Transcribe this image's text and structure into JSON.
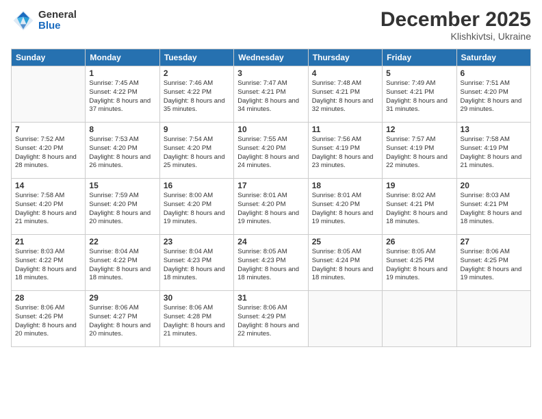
{
  "logo": {
    "general": "General",
    "blue": "Blue"
  },
  "title": "December 2025",
  "location": "Klishkivtsi, Ukraine",
  "days_header": [
    "Sunday",
    "Monday",
    "Tuesday",
    "Wednesday",
    "Thursday",
    "Friday",
    "Saturday"
  ],
  "weeks": [
    [
      {
        "day": "",
        "sunrise": "",
        "sunset": "",
        "daylight": ""
      },
      {
        "day": "1",
        "sunrise": "Sunrise: 7:45 AM",
        "sunset": "Sunset: 4:22 PM",
        "daylight": "Daylight: 8 hours and 37 minutes."
      },
      {
        "day": "2",
        "sunrise": "Sunrise: 7:46 AM",
        "sunset": "Sunset: 4:22 PM",
        "daylight": "Daylight: 8 hours and 35 minutes."
      },
      {
        "day": "3",
        "sunrise": "Sunrise: 7:47 AM",
        "sunset": "Sunset: 4:21 PM",
        "daylight": "Daylight: 8 hours and 34 minutes."
      },
      {
        "day": "4",
        "sunrise": "Sunrise: 7:48 AM",
        "sunset": "Sunset: 4:21 PM",
        "daylight": "Daylight: 8 hours and 32 minutes."
      },
      {
        "day": "5",
        "sunrise": "Sunrise: 7:49 AM",
        "sunset": "Sunset: 4:21 PM",
        "daylight": "Daylight: 8 hours and 31 minutes."
      },
      {
        "day": "6",
        "sunrise": "Sunrise: 7:51 AM",
        "sunset": "Sunset: 4:20 PM",
        "daylight": "Daylight: 8 hours and 29 minutes."
      }
    ],
    [
      {
        "day": "7",
        "sunrise": "Sunrise: 7:52 AM",
        "sunset": "Sunset: 4:20 PM",
        "daylight": "Daylight: 8 hours and 28 minutes."
      },
      {
        "day": "8",
        "sunrise": "Sunrise: 7:53 AM",
        "sunset": "Sunset: 4:20 PM",
        "daylight": "Daylight: 8 hours and 26 minutes."
      },
      {
        "day": "9",
        "sunrise": "Sunrise: 7:54 AM",
        "sunset": "Sunset: 4:20 PM",
        "daylight": "Daylight: 8 hours and 25 minutes."
      },
      {
        "day": "10",
        "sunrise": "Sunrise: 7:55 AM",
        "sunset": "Sunset: 4:20 PM",
        "daylight": "Daylight: 8 hours and 24 minutes."
      },
      {
        "day": "11",
        "sunrise": "Sunrise: 7:56 AM",
        "sunset": "Sunset: 4:19 PM",
        "daylight": "Daylight: 8 hours and 23 minutes."
      },
      {
        "day": "12",
        "sunrise": "Sunrise: 7:57 AM",
        "sunset": "Sunset: 4:19 PM",
        "daylight": "Daylight: 8 hours and 22 minutes."
      },
      {
        "day": "13",
        "sunrise": "Sunrise: 7:58 AM",
        "sunset": "Sunset: 4:19 PM",
        "daylight": "Daylight: 8 hours and 21 minutes."
      }
    ],
    [
      {
        "day": "14",
        "sunrise": "Sunrise: 7:58 AM",
        "sunset": "Sunset: 4:20 PM",
        "daylight": "Daylight: 8 hours and 21 minutes."
      },
      {
        "day": "15",
        "sunrise": "Sunrise: 7:59 AM",
        "sunset": "Sunset: 4:20 PM",
        "daylight": "Daylight: 8 hours and 20 minutes."
      },
      {
        "day": "16",
        "sunrise": "Sunrise: 8:00 AM",
        "sunset": "Sunset: 4:20 PM",
        "daylight": "Daylight: 8 hours and 19 minutes."
      },
      {
        "day": "17",
        "sunrise": "Sunrise: 8:01 AM",
        "sunset": "Sunset: 4:20 PM",
        "daylight": "Daylight: 8 hours and 19 minutes."
      },
      {
        "day": "18",
        "sunrise": "Sunrise: 8:01 AM",
        "sunset": "Sunset: 4:20 PM",
        "daylight": "Daylight: 8 hours and 19 minutes."
      },
      {
        "day": "19",
        "sunrise": "Sunrise: 8:02 AM",
        "sunset": "Sunset: 4:21 PM",
        "daylight": "Daylight: 8 hours and 18 minutes."
      },
      {
        "day": "20",
        "sunrise": "Sunrise: 8:03 AM",
        "sunset": "Sunset: 4:21 PM",
        "daylight": "Daylight: 8 hours and 18 minutes."
      }
    ],
    [
      {
        "day": "21",
        "sunrise": "Sunrise: 8:03 AM",
        "sunset": "Sunset: 4:22 PM",
        "daylight": "Daylight: 8 hours and 18 minutes."
      },
      {
        "day": "22",
        "sunrise": "Sunrise: 8:04 AM",
        "sunset": "Sunset: 4:22 PM",
        "daylight": "Daylight: 8 hours and 18 minutes."
      },
      {
        "day": "23",
        "sunrise": "Sunrise: 8:04 AM",
        "sunset": "Sunset: 4:23 PM",
        "daylight": "Daylight: 8 hours and 18 minutes."
      },
      {
        "day": "24",
        "sunrise": "Sunrise: 8:05 AM",
        "sunset": "Sunset: 4:23 PM",
        "daylight": "Daylight: 8 hours and 18 minutes."
      },
      {
        "day": "25",
        "sunrise": "Sunrise: 8:05 AM",
        "sunset": "Sunset: 4:24 PM",
        "daylight": "Daylight: 8 hours and 18 minutes."
      },
      {
        "day": "26",
        "sunrise": "Sunrise: 8:05 AM",
        "sunset": "Sunset: 4:25 PM",
        "daylight": "Daylight: 8 hours and 19 minutes."
      },
      {
        "day": "27",
        "sunrise": "Sunrise: 8:06 AM",
        "sunset": "Sunset: 4:25 PM",
        "daylight": "Daylight: 8 hours and 19 minutes."
      }
    ],
    [
      {
        "day": "28",
        "sunrise": "Sunrise: 8:06 AM",
        "sunset": "Sunset: 4:26 PM",
        "daylight": "Daylight: 8 hours and 20 minutes."
      },
      {
        "day": "29",
        "sunrise": "Sunrise: 8:06 AM",
        "sunset": "Sunset: 4:27 PM",
        "daylight": "Daylight: 8 hours and 20 minutes."
      },
      {
        "day": "30",
        "sunrise": "Sunrise: 8:06 AM",
        "sunset": "Sunset: 4:28 PM",
        "daylight": "Daylight: 8 hours and 21 minutes."
      },
      {
        "day": "31",
        "sunrise": "Sunrise: 8:06 AM",
        "sunset": "Sunset: 4:29 PM",
        "daylight": "Daylight: 8 hours and 22 minutes."
      },
      {
        "day": "",
        "sunrise": "",
        "sunset": "",
        "daylight": ""
      },
      {
        "day": "",
        "sunrise": "",
        "sunset": "",
        "daylight": ""
      },
      {
        "day": "",
        "sunrise": "",
        "sunset": "",
        "daylight": ""
      }
    ]
  ]
}
